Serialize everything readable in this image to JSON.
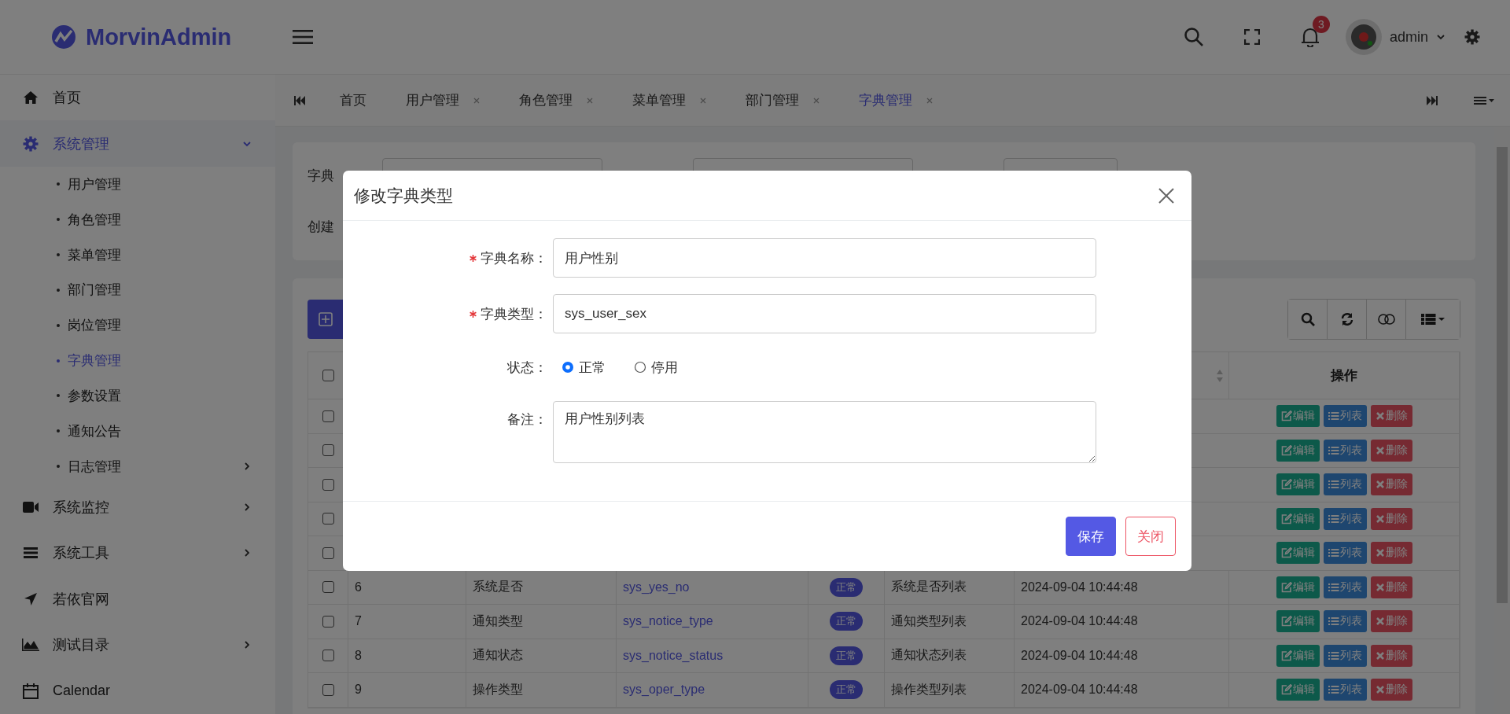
{
  "header": {
    "logo": "MorvinAdmin",
    "notification_count": "3",
    "user": "admin"
  },
  "sidebar": {
    "items": [
      {
        "label": "首页",
        "expandable": false,
        "selected": false
      },
      {
        "label": "系统管理",
        "expandable": true,
        "expanded": true,
        "selected": true,
        "children": [
          {
            "label": "用户管理",
            "selected": false,
            "expandable": false
          },
          {
            "label": "角色管理",
            "selected": false,
            "expandable": false
          },
          {
            "label": "菜单管理",
            "selected": false,
            "expandable": false
          },
          {
            "label": "部门管理",
            "selected": false,
            "expandable": false
          },
          {
            "label": "岗位管理",
            "selected": false,
            "expandable": false
          },
          {
            "label": "字典管理",
            "selected": true,
            "expandable": false
          },
          {
            "label": "参数设置",
            "selected": false,
            "expandable": false
          },
          {
            "label": "通知公告",
            "selected": false,
            "expandable": false
          },
          {
            "label": "日志管理",
            "selected": false,
            "expandable": true
          }
        ]
      },
      {
        "label": "系统监控",
        "expandable": true,
        "expanded": false,
        "selected": false
      },
      {
        "label": "系统工具",
        "expandable": true,
        "expanded": false,
        "selected": false
      },
      {
        "label": "若依官网",
        "expandable": false,
        "selected": false
      },
      {
        "label": "测试目录",
        "expandable": true,
        "expanded": false,
        "selected": false
      },
      {
        "label": "Calendar",
        "expandable": false,
        "selected": false
      }
    ]
  },
  "tabs": [
    {
      "label": "首页",
      "selected": false,
      "closable": false
    },
    {
      "label": "用户管理",
      "selected": false,
      "closable": true
    },
    {
      "label": "角色管理",
      "selected": false,
      "closable": true
    },
    {
      "label": "菜单管理",
      "selected": false,
      "closable": true
    },
    {
      "label": "部门管理",
      "selected": false,
      "closable": true
    },
    {
      "label": "字典管理",
      "selected": true,
      "closable": true
    }
  ],
  "search_form": {
    "labels": [
      "字典",
      "创建"
    ]
  },
  "table": {
    "header_checked": false,
    "columns": [
      {
        "label": "操作"
      }
    ],
    "rows": [
      {
        "checked": false,
        "actions": [
          {
            "kind": "edit",
            "label": "编辑"
          },
          {
            "kind": "list",
            "label": "列表"
          },
          {
            "kind": "delete",
            "label": "删除"
          }
        ]
      },
      {
        "checked": false,
        "actions": [
          {
            "kind": "edit",
            "label": "编辑"
          },
          {
            "kind": "list",
            "label": "列表"
          },
          {
            "kind": "delete",
            "label": "删除"
          }
        ]
      },
      {
        "checked": false,
        "actions": [
          {
            "kind": "edit",
            "label": "编辑"
          },
          {
            "kind": "list",
            "label": "列表"
          },
          {
            "kind": "delete",
            "label": "删除"
          }
        ]
      },
      {
        "checked": false,
        "actions": [
          {
            "kind": "edit",
            "label": "编辑"
          },
          {
            "kind": "list",
            "label": "列表"
          },
          {
            "kind": "delete",
            "label": "删除"
          }
        ]
      },
      {
        "checked": false,
        "actions": [
          {
            "kind": "edit",
            "label": "编辑"
          },
          {
            "kind": "list",
            "label": "列表"
          },
          {
            "kind": "delete",
            "label": "删除"
          }
        ]
      },
      {
        "checked": false,
        "cells": [
          {
            "kind": "text",
            "text": "6"
          },
          {
            "kind": "text",
            "text": "系统是否"
          },
          {
            "kind": "link",
            "text": "sys_yes_no"
          },
          {
            "kind": "badge",
            "text": "正常"
          },
          {
            "kind": "text",
            "text": "系统是否列表"
          },
          {
            "kind": "text",
            "text": "2024-09-04 10:44:48"
          }
        ],
        "actions": [
          {
            "kind": "edit",
            "label": "编辑"
          },
          {
            "kind": "list",
            "label": "列表"
          },
          {
            "kind": "delete",
            "label": "删除"
          }
        ]
      },
      {
        "checked": false,
        "cells": [
          {
            "kind": "text",
            "text": "7"
          },
          {
            "kind": "text",
            "text": "通知类型"
          },
          {
            "kind": "link",
            "text": "sys_notice_type"
          },
          {
            "kind": "badge",
            "text": "正常"
          },
          {
            "kind": "text",
            "text": "通知类型列表"
          },
          {
            "kind": "text",
            "text": "2024-09-04 10:44:48"
          }
        ],
        "actions": [
          {
            "kind": "edit",
            "label": "编辑"
          },
          {
            "kind": "list",
            "label": "列表"
          },
          {
            "kind": "delete",
            "label": "删除"
          }
        ]
      },
      {
        "checked": false,
        "cells": [
          {
            "kind": "text",
            "text": "8"
          },
          {
            "kind": "text",
            "text": "通知状态"
          },
          {
            "kind": "link",
            "text": "sys_notice_status"
          },
          {
            "kind": "badge",
            "text": "正常"
          },
          {
            "kind": "text",
            "text": "通知状态列表"
          },
          {
            "kind": "text",
            "text": "2024-09-04 10:44:48"
          }
        ],
        "actions": [
          {
            "kind": "edit",
            "label": "编辑"
          },
          {
            "kind": "list",
            "label": "列表"
          },
          {
            "kind": "delete",
            "label": "删除"
          }
        ]
      },
      {
        "checked": false,
        "cells": [
          {
            "kind": "text",
            "text": "9"
          },
          {
            "kind": "text",
            "text": "操作类型"
          },
          {
            "kind": "link",
            "text": "sys_oper_type"
          },
          {
            "kind": "badge",
            "text": "正常"
          },
          {
            "kind": "text",
            "text": "操作类型列表"
          },
          {
            "kind": "text",
            "text": "2024-09-04 10:44:48"
          }
        ],
        "actions": [
          {
            "kind": "edit",
            "label": "编辑"
          },
          {
            "kind": "list",
            "label": "列表"
          },
          {
            "kind": "delete",
            "label": "删除"
          }
        ]
      }
    ]
  },
  "modal": {
    "title": "修改字典类型",
    "fields": [
      {
        "kind": "input",
        "label": "字典名称：",
        "required": true,
        "value": "用户性别"
      },
      {
        "kind": "input",
        "label": "字典类型：",
        "required": true,
        "value": "sys_user_sex"
      },
      {
        "kind": "radio",
        "label": "状态：",
        "required": false,
        "options": [
          {
            "label": "正常",
            "selected": true
          },
          {
            "label": "停用",
            "selected": false
          }
        ]
      },
      {
        "kind": "textarea",
        "label": "备注：",
        "required": false,
        "value": "用户性别列表"
      }
    ],
    "buttons": [
      {
        "kind": "primary",
        "label": "保存"
      },
      {
        "kind": "outline",
        "label": "关闭"
      }
    ]
  }
}
